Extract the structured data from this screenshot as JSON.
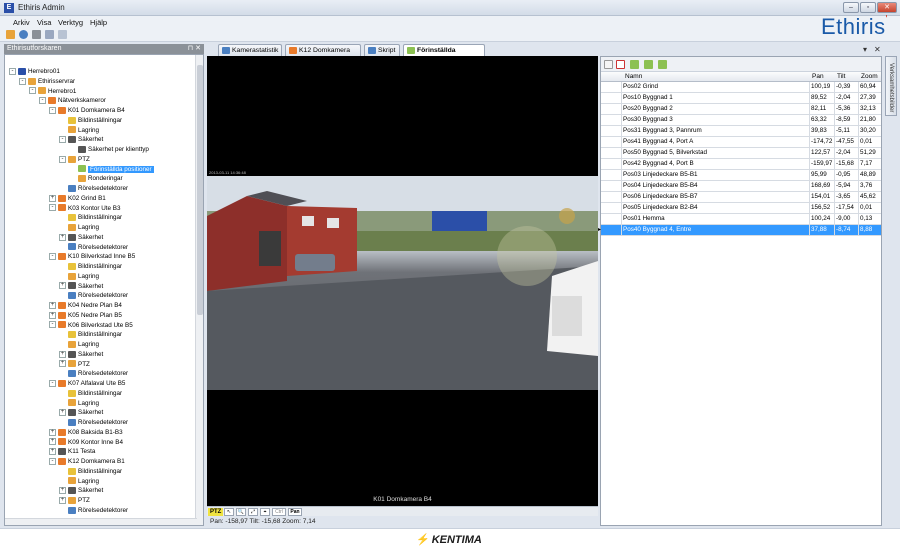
{
  "window": {
    "title": "Ethiris Admin",
    "minimize": "–",
    "restore": "▫",
    "close": "✕"
  },
  "menu": [
    "Arkiv",
    "Visa",
    "Verktyg",
    "Hjälp"
  ],
  "logo": {
    "text": "Ethiris",
    "mark": "'"
  },
  "explorer": {
    "title": "Ethirisutforskaren",
    "pin": "⊓ ✕",
    "items": [
      {
        "label": "Herrebro01",
        "depth": 0,
        "exp": "-",
        "icon": "server-icon",
        "color": "#2a4fa8"
      },
      {
        "label": "Ethirisservrar",
        "depth": 1,
        "exp": "-",
        "icon": "folder-icon",
        "color": "#e8a33a"
      },
      {
        "label": "Herrebro1",
        "depth": 2,
        "exp": "-",
        "icon": "server-icon",
        "color": "#e8a33a"
      },
      {
        "label": "Nätverkskameror",
        "depth": 3,
        "exp": "-",
        "icon": "camera-group-icon",
        "color": "#e87a2a"
      },
      {
        "label": "K01 Domkamera B4",
        "depth": 4,
        "exp": "-",
        "icon": "camera-icon",
        "color": "#e87a2a"
      },
      {
        "label": "Bildinställningar",
        "depth": 5,
        "exp": "",
        "icon": "image-settings-icon",
        "color": "#e8c23a"
      },
      {
        "label": "Lagring",
        "depth": 5,
        "exp": "",
        "icon": "storage-icon",
        "color": "#e8a33a"
      },
      {
        "label": "Säkerhet",
        "depth": 5,
        "exp": "-",
        "icon": "security-icon",
        "color": "#555555"
      },
      {
        "label": "Säkerhet per klienttyp",
        "depth": 6,
        "exp": "",
        "icon": "security-icon",
        "color": "#555555"
      },
      {
        "label": "PTZ",
        "depth": 5,
        "exp": "-",
        "icon": "ptz-icon",
        "color": "#e8a33a"
      },
      {
        "label": "Förinställda positioner",
        "depth": 6,
        "exp": "",
        "icon": "preset-icon",
        "color": "#8cc152",
        "selected": true
      },
      {
        "label": "Ronderingar",
        "depth": 6,
        "exp": "",
        "icon": "tour-icon",
        "color": "#e8a33a"
      },
      {
        "label": "Rörelsedetektorer",
        "depth": 5,
        "exp": "",
        "icon": "motion-icon",
        "color": "#4a7fc1"
      },
      {
        "label": "K02 Grind B1",
        "depth": 4,
        "exp": "+",
        "icon": "camera-icon",
        "color": "#e87a2a"
      },
      {
        "label": "K03 Kontor Ute B3",
        "depth": 4,
        "exp": "-",
        "icon": "camera-icon",
        "color": "#e87a2a"
      },
      {
        "label": "Bildinställningar",
        "depth": 5,
        "exp": "",
        "icon": "image-settings-icon",
        "color": "#e8c23a"
      },
      {
        "label": "Lagring",
        "depth": 5,
        "exp": "",
        "icon": "storage-icon",
        "color": "#e8a33a"
      },
      {
        "label": "Säkerhet",
        "depth": 5,
        "exp": "+",
        "icon": "security-icon",
        "color": "#555555"
      },
      {
        "label": "Rörelsedetektorer",
        "depth": 5,
        "exp": "",
        "icon": "motion-icon",
        "color": "#4a7fc1"
      },
      {
        "label": "K10 Bilverkstad Inne B5",
        "depth": 4,
        "exp": "-",
        "icon": "camera-icon",
        "color": "#e87a2a"
      },
      {
        "label": "Bildinställningar",
        "depth": 5,
        "exp": "",
        "icon": "image-settings-icon",
        "color": "#e8c23a"
      },
      {
        "label": "Lagring",
        "depth": 5,
        "exp": "",
        "icon": "storage-icon",
        "color": "#e8a33a"
      },
      {
        "label": "Säkerhet",
        "depth": 5,
        "exp": "+",
        "icon": "security-icon",
        "color": "#555555"
      },
      {
        "label": "Rörelsedetektorer",
        "depth": 5,
        "exp": "",
        "icon": "motion-icon",
        "color": "#4a7fc1"
      },
      {
        "label": "K04 Nedre Plan B4",
        "depth": 4,
        "exp": "+",
        "icon": "camera-icon",
        "color": "#e87a2a"
      },
      {
        "label": "K05 Nedre Plan B5",
        "depth": 4,
        "exp": "+",
        "icon": "camera-icon",
        "color": "#e87a2a"
      },
      {
        "label": "K06 Bilverkstad Ute B5",
        "depth": 4,
        "exp": "-",
        "icon": "camera-icon",
        "color": "#e87a2a"
      },
      {
        "label": "Bildinställningar",
        "depth": 5,
        "exp": "",
        "icon": "image-settings-icon",
        "color": "#e8c23a"
      },
      {
        "label": "Lagring",
        "depth": 5,
        "exp": "",
        "icon": "storage-icon",
        "color": "#e8a33a"
      },
      {
        "label": "Säkerhet",
        "depth": 5,
        "exp": "+",
        "icon": "security-icon",
        "color": "#555555"
      },
      {
        "label": "PTZ",
        "depth": 5,
        "exp": "+",
        "icon": "ptz-icon",
        "color": "#e8a33a"
      },
      {
        "label": "Rörelsedetektorer",
        "depth": 5,
        "exp": "",
        "icon": "motion-icon",
        "color": "#4a7fc1"
      },
      {
        "label": "K07 Alfalaval Ute B5",
        "depth": 4,
        "exp": "-",
        "icon": "camera-icon",
        "color": "#e87a2a"
      },
      {
        "label": "Bildinställningar",
        "depth": 5,
        "exp": "",
        "icon": "image-settings-icon",
        "color": "#e8c23a"
      },
      {
        "label": "Lagring",
        "depth": 5,
        "exp": "",
        "icon": "storage-icon",
        "color": "#e8a33a"
      },
      {
        "label": "Säkerhet",
        "depth": 5,
        "exp": "+",
        "icon": "security-icon",
        "color": "#555555"
      },
      {
        "label": "Rörelsedetektorer",
        "depth": 5,
        "exp": "",
        "icon": "motion-icon",
        "color": "#4a7fc1"
      },
      {
        "label": "K08 Baksida B1-B3",
        "depth": 4,
        "exp": "+",
        "icon": "camera-icon",
        "color": "#e87a2a"
      },
      {
        "label": "K09 Kontor Inne B4",
        "depth": 4,
        "exp": "+",
        "icon": "camera-icon",
        "color": "#e87a2a"
      },
      {
        "label": "K11 Testa",
        "depth": 4,
        "exp": "+",
        "icon": "camera-icon",
        "color": "#555555"
      },
      {
        "label": "K12 Domkamera B1",
        "depth": 4,
        "exp": "-",
        "icon": "camera-icon",
        "color": "#e87a2a"
      },
      {
        "label": "Bildinställningar",
        "depth": 5,
        "exp": "",
        "icon": "image-settings-icon",
        "color": "#e8c23a"
      },
      {
        "label": "Lagring",
        "depth": 5,
        "exp": "",
        "icon": "storage-icon",
        "color": "#e8a33a"
      },
      {
        "label": "Säkerhet",
        "depth": 5,
        "exp": "+",
        "icon": "security-icon",
        "color": "#555555"
      },
      {
        "label": "PTZ",
        "depth": 5,
        "exp": "+",
        "icon": "ptz-icon",
        "color": "#e8a33a"
      },
      {
        "label": "Rörelsedetektorer",
        "depth": 5,
        "exp": "",
        "icon": "motion-icon",
        "color": "#4a7fc1"
      }
    ]
  },
  "tabs": [
    {
      "label": "Kamerastatistik",
      "icon": "stats-icon",
      "color": "#4a7fc1"
    },
    {
      "label": "K12 Domkamera B1",
      "icon": "camera-icon",
      "color": "#e87a2a"
    },
    {
      "label": "Skript",
      "icon": "script-icon",
      "color": "#4a7fc1"
    },
    {
      "label": "Förinställda positioner",
      "icon": "preset-icon",
      "color": "#8cc152",
      "active": true
    }
  ],
  "tab_controls": {
    "dropdown": "▾",
    "close": "✕"
  },
  "video": {
    "camera_name": "K01 Domkamera B4",
    "timestamp": "2013-03-11 14:36:48",
    "ptz_label": "PTZ",
    "ptz_tools": [
      "↖",
      "🔍",
      "⤢",
      "⌖",
      "Ctrl",
      "Pan"
    ],
    "status": "Pan: -158,97  Tilt: -15,68  Zoom: 7,14"
  },
  "presets": {
    "columns": [
      "Namn",
      "Pan",
      "Tilt",
      "Zoom"
    ],
    "rows": [
      {
        "name": "Pos02 Grind",
        "pan": "100,19",
        "tilt": "-0,39",
        "zoom": "60,94"
      },
      {
        "name": "Pos10 Byggnad 1",
        "pan": "89,52",
        "tilt": "-2,04",
        "zoom": "27,39"
      },
      {
        "name": "Pos20 Byggnad 2",
        "pan": "82,11",
        "tilt": "-5,36",
        "zoom": "32,13"
      },
      {
        "name": "Pos30 Byggnad 3",
        "pan": "63,32",
        "tilt": "-8,59",
        "zoom": "21,80"
      },
      {
        "name": "Pos31 Byggnad 3, Pannrum",
        "pan": "39,83",
        "tilt": "-5,11",
        "zoom": "30,20"
      },
      {
        "name": "Pos41 Byggnad 4, Port A",
        "pan": "-174,72",
        "tilt": "-47,55",
        "zoom": "0,01"
      },
      {
        "name": "Pos50 Byggnad 5, Bilverkstad",
        "pan": "122,57",
        "tilt": "-2,04",
        "zoom": "51,29"
      },
      {
        "name": "Pos42 Byggnad 4, Port B",
        "pan": "-159,97",
        "tilt": "-15,68",
        "zoom": "7,17"
      },
      {
        "name": "Pos03 Linjedeckare B5-B1",
        "pan": "95,99",
        "tilt": "-0,95",
        "zoom": "48,89"
      },
      {
        "name": "Pos04 Linjedeckare B5-B4",
        "pan": "168,69",
        "tilt": "-5,94",
        "zoom": "3,76"
      },
      {
        "name": "Pos06 Linjedeckare B5-B7",
        "pan": "154,01",
        "tilt": "-3,65",
        "zoom": "45,62"
      },
      {
        "name": "Pos05 Linjedeckare B2-B4",
        "pan": "156,52",
        "tilt": "-17,54",
        "zoom": "0,01"
      },
      {
        "name": "Pos01 Hemma",
        "pan": "100,24",
        "tilt": "-9,00",
        "zoom": "0,13"
      },
      {
        "name": "Pos40 Byggnad 4, Entre",
        "pan": "37,88",
        "tilt": "-8,74",
        "zoom": "8,88",
        "selected": true
      }
    ]
  },
  "side_tab": "Verksamhetsbilder",
  "footer": {
    "brand": "KENTIMA",
    "bolt": "⚡"
  }
}
